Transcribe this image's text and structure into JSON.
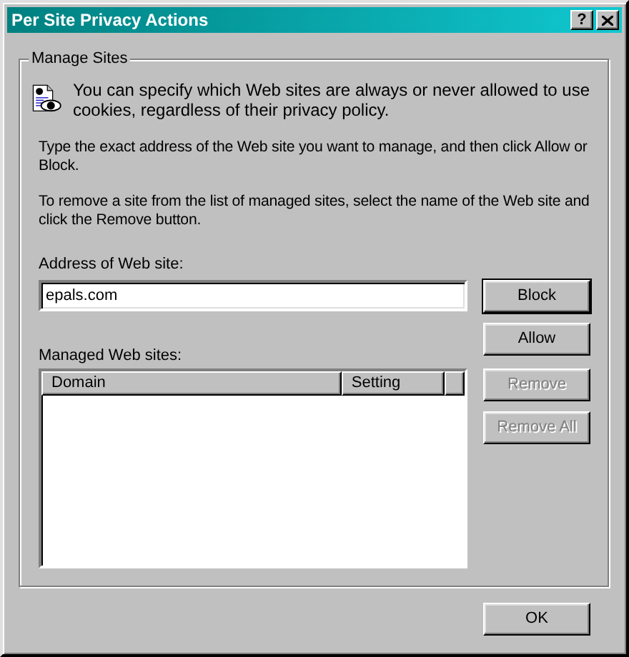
{
  "window": {
    "title": "Per Site Privacy Actions",
    "help_button": "?"
  },
  "group": {
    "legend": "Manage Sites",
    "intro": "You can specify which Web sites are always or never allowed to use cookies, regardless of their privacy policy.",
    "paragraphs": [
      "Type the exact address of the Web site you want to manage, and then click Allow or Block.",
      "To remove a site from the list of managed sites, select the name of the Web site and click the Remove button."
    ],
    "address_label": "Address of Web site:",
    "address_value": "epals.com",
    "address_buttons": [
      {
        "label": "Block",
        "default": true,
        "disabled": false
      },
      {
        "label": "Allow",
        "default": false,
        "disabled": false
      }
    ],
    "list_label": "Managed Web sites:",
    "list_columns": [
      "Domain",
      "Setting"
    ],
    "list_buttons": [
      {
        "label": "Remove",
        "default": false,
        "disabled": true
      },
      {
        "label": "Remove All",
        "default": false,
        "disabled": true
      }
    ]
  },
  "footer_buttons": [
    {
      "label": "OK",
      "default": false,
      "disabled": false
    }
  ]
}
